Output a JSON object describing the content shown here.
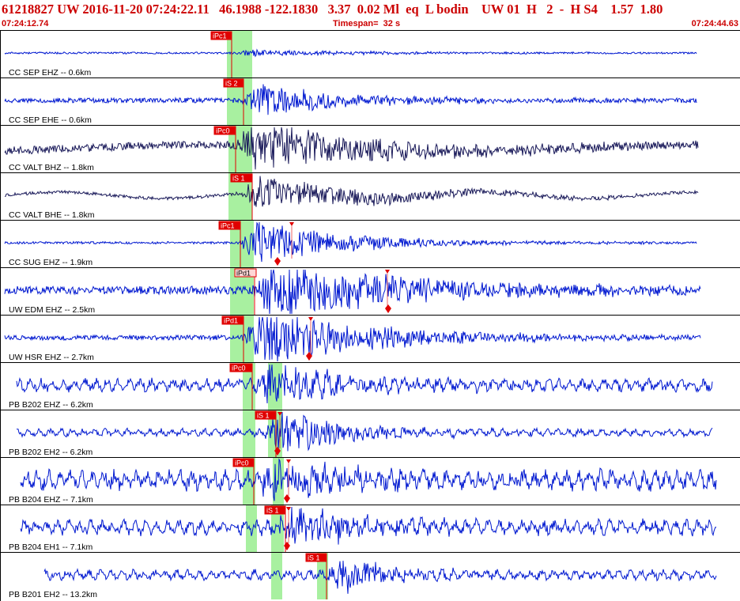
{
  "header": {
    "title": "61218827 UW 2016-11-20 07:24:22.11   46.1988 -122.1830   3.37  0.02 Ml  eq  L bodin    UW 01  H   2  -  H S4    1.57  1.80",
    "start_time": "07:24:12.74",
    "timespan": "Timespan=  32 s",
    "end_time": "07:24:44.63"
  },
  "colors": {
    "trace_blue": "#0018d0",
    "trace_dark": "#1a1a5a",
    "pick_red": "#e00000",
    "window_green": "#a8f0a0"
  },
  "channels": [
    {
      "label": "CC SEP EHZ -- 0.6km",
      "pick": "iPc1"
    },
    {
      "label": "CC SEP EHE -- 0.6km",
      "pick": "iS 2"
    },
    {
      "label": "CC VALT BHZ -- 1.8km",
      "pick": "iPc0"
    },
    {
      "label": "CC VALT BHE -- 1.8km",
      "pick": "iS 1"
    },
    {
      "label": "CC SUG EHZ -- 1.9km",
      "pick": "iPc1"
    },
    {
      "label": "UW EDM EHZ -- 2.5km",
      "pick": "iPd1"
    },
    {
      "label": "UW HSR EHZ -- 2.7km",
      "pick": "iPd1"
    },
    {
      "label": "PB B202 EHZ -- 6.2km",
      "pick": "iPc0"
    },
    {
      "label": "PB B202 EH2 -- 6.2km",
      "pick": "iS 1"
    },
    {
      "label": "PB B204 EHZ -- 7.1km",
      "pick": "iPc0"
    },
    {
      "label": "PB B204 EH1 -- 7.1km",
      "pick": "iS 1"
    },
    {
      "label": "PB B201 EH2 -- 13.2km",
      "pick": "iS 1"
    }
  ]
}
